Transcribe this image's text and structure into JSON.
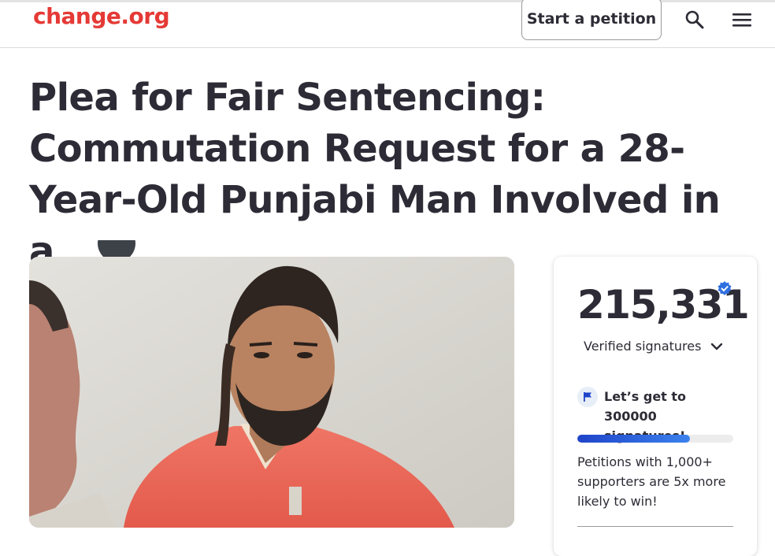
{
  "header": {
    "logo": "change.org",
    "start_petition_label": "Start a petition",
    "search_icon": "search-icon",
    "menu_icon": "hamburger-menu-icon",
    "brand_color": "#e53935"
  },
  "petition": {
    "title": "Plea for Fair Sentencing: Commutation Request for a 28-Year-Old Punjabi Man Involved in a"
  },
  "signatures": {
    "count": "215,331",
    "verified_label": "Verified signatures",
    "goal_text": "Let’s get to 300000 signatures!",
    "progress_fraction": 0.72,
    "tip": "Petitions with 1,000+ supporters are 5x more likely to win!",
    "accent_color": "#2f5fd8"
  }
}
